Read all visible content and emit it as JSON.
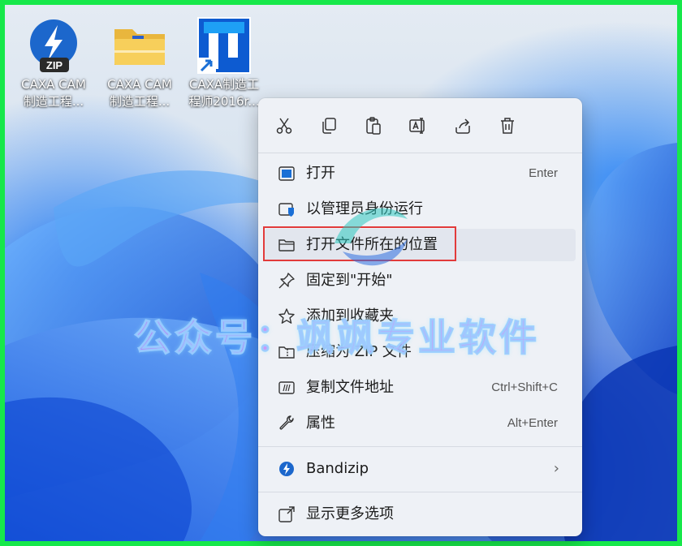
{
  "desktop": {
    "icons": [
      {
        "line1": "CAXA CAM",
        "line2": "制造工程..."
      },
      {
        "line1": "CAXA CAM",
        "line2": "制造工程..."
      },
      {
        "line1": "CAXA制造工",
        "line2": "程师2016r..."
      }
    ],
    "zip_badge": "ZIP"
  },
  "toolbar": {
    "icons": [
      "cut-icon",
      "copy-icon",
      "paste-icon",
      "rename-icon",
      "share-icon",
      "delete-icon"
    ]
  },
  "menu": {
    "items": [
      {
        "label": "打开",
        "shortcut": "Enter",
        "icon": "open-icon"
      },
      {
        "label": "以管理员身份运行",
        "shortcut": "",
        "icon": "admin-shield-icon"
      },
      {
        "label": "打开文件所在的位置",
        "shortcut": "",
        "icon": "folder-icon"
      },
      {
        "label": "固定到\"开始\"",
        "shortcut": "",
        "icon": "pin-icon"
      },
      {
        "label": "添加到收藏夹",
        "shortcut": "",
        "icon": "star-icon"
      },
      {
        "label": "压缩为 ZIP 文件",
        "shortcut": "",
        "icon": "zip-folder-icon"
      },
      {
        "label": "复制文件地址",
        "shortcut": "Ctrl+Shift+C",
        "icon": "copy-path-icon"
      },
      {
        "label": "属性",
        "shortcut": "Alt+Enter",
        "icon": "wrench-icon"
      },
      {
        "label": "Bandizip",
        "shortcut": "",
        "icon": "bandizip-icon"
      },
      {
        "label": "显示更多选项",
        "shortcut": "",
        "icon": "more-options-icon"
      }
    ]
  },
  "watermark": {
    "text": "公众号：飒飒专业软件"
  },
  "colors": {
    "highlight": "#e23b3b",
    "frame": "#17e84a",
    "accent": "#1a6fd6"
  }
}
